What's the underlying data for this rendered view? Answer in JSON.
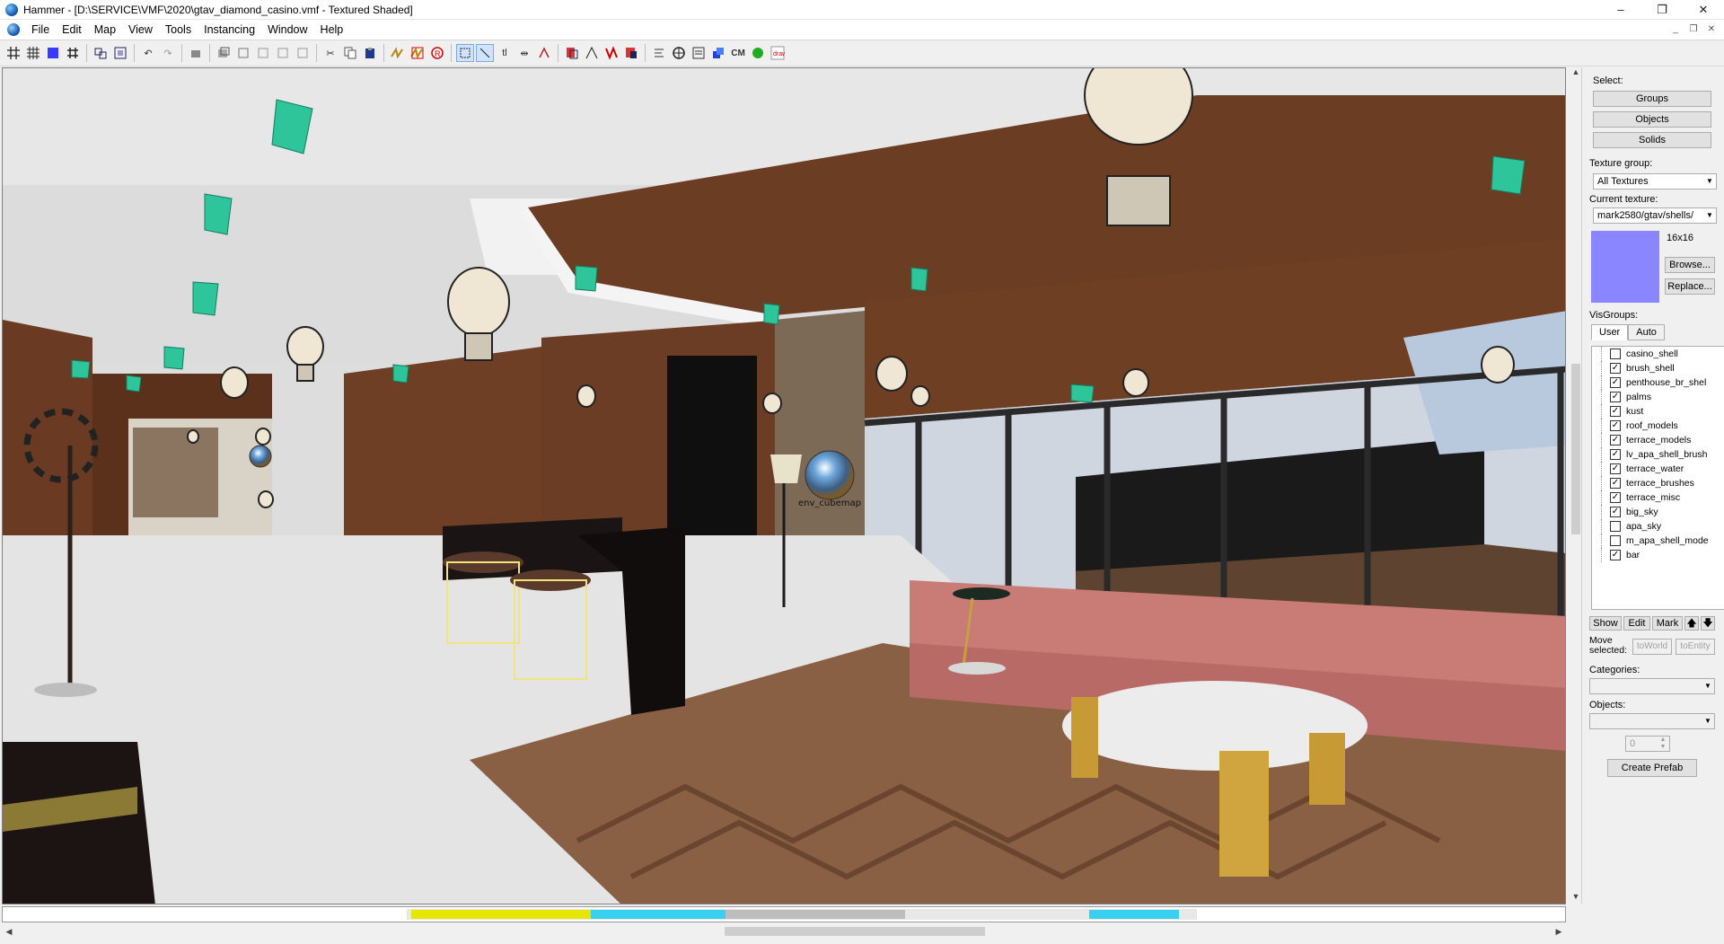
{
  "window": {
    "title": "Hammer - [D:\\SERVICE\\VMF\\2020\\gtav_diamond_casino.vmf - Textured Shaded]",
    "minimize": "–",
    "maximize": "❐",
    "close": "✕"
  },
  "menu": {
    "items": [
      "File",
      "Edit",
      "Map",
      "View",
      "Tools",
      "Instancing",
      "Window",
      "Help"
    ]
  },
  "toolbar": {
    "cm_label": "CM"
  },
  "viewport": {
    "entity_label": "env_cubemap"
  },
  "panel": {
    "select_label": "Select:",
    "groups_button": "Groups",
    "objects_button": "Objects",
    "solids_button": "Solids",
    "texture_group_label": "Texture group:",
    "texture_group_value": "All Textures",
    "current_texture_label": "Current texture:",
    "current_texture_value": "mark2580/gtav/shells/",
    "texture_size": "16x16",
    "browse_button": "Browse...",
    "replace_button": "Replace...",
    "swatch_color": "#8a86ff",
    "visgroups_label": "VisGroups:",
    "tab_user": "User",
    "tab_auto": "Auto",
    "visgroups": [
      {
        "name": "casino_shell",
        "checked": false
      },
      {
        "name": "brush_shell",
        "checked": true
      },
      {
        "name": "penthouse_br_shel",
        "checked": true
      },
      {
        "name": "palms",
        "checked": true
      },
      {
        "name": "kust",
        "checked": true
      },
      {
        "name": "roof_models",
        "checked": true
      },
      {
        "name": "terrace_models",
        "checked": true
      },
      {
        "name": "lv_apa_shell_brush",
        "checked": true
      },
      {
        "name": "terrace_water",
        "checked": true
      },
      {
        "name": "terrace_brushes",
        "checked": true
      },
      {
        "name": "terrace_misc",
        "checked": true
      },
      {
        "name": "big_sky",
        "checked": true
      },
      {
        "name": "apa_sky",
        "checked": false
      },
      {
        "name": "m_apa_shell_mode",
        "checked": false
      },
      {
        "name": "bar",
        "checked": true
      }
    ],
    "show_button": "Show",
    "edit_button": "Edit",
    "mark_button": "Mark",
    "move_selected_label": "Move selected:",
    "to_world_button": "toWorld",
    "to_entity_button": "toEntity",
    "categories_label": "Categories:",
    "objects_label": "Objects:",
    "spin_value": "0",
    "create_prefab_button": "Create Prefab"
  }
}
